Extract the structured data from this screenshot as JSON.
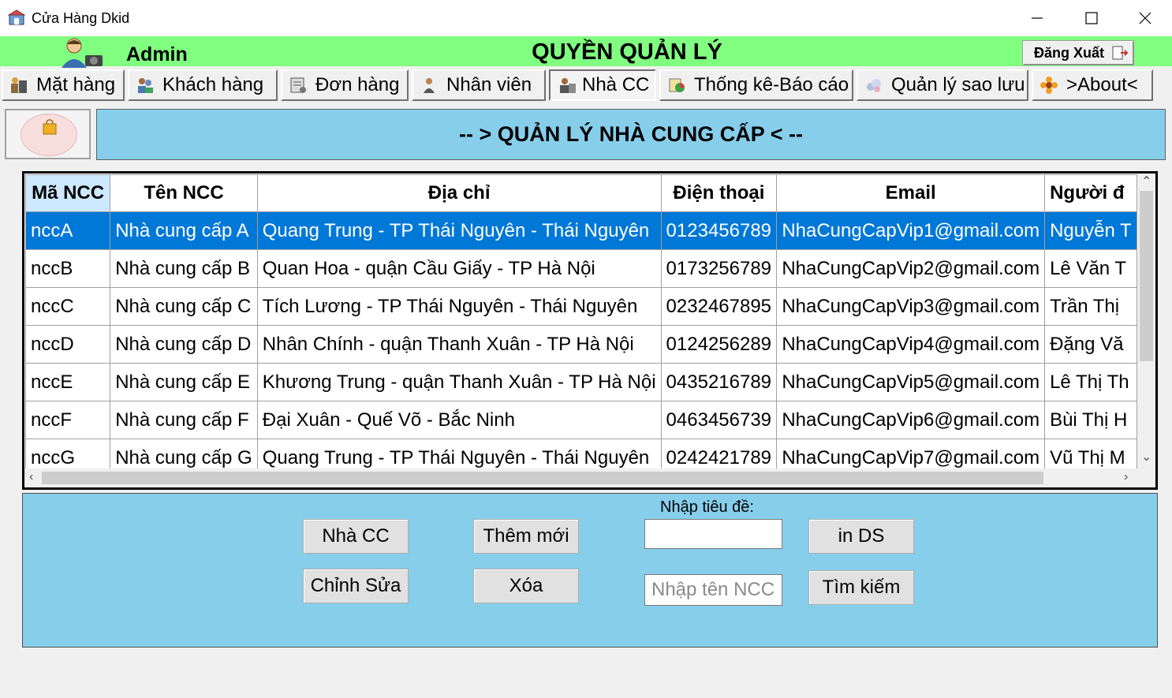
{
  "window": {
    "title": "Cửa Hàng Dkid"
  },
  "header": {
    "user": "Admin",
    "role_title": "QUYỀN QUẢN LÝ",
    "logout": "Đăng Xuất"
  },
  "tabs": [
    {
      "label": "Mặt hàng"
    },
    {
      "label": "Khách hàng"
    },
    {
      "label": "Đơn hàng"
    },
    {
      "label": "Nhân viên"
    },
    {
      "label": "Nhà CC"
    },
    {
      "label": "Thống kê-Báo cáo"
    },
    {
      "label": "Quản lý sao lưu"
    },
    {
      "label": ">About<"
    }
  ],
  "active_tab": "Nhà CC",
  "page_heading": "-- > QUẢN LÝ NHÀ CUNG CẤP < --",
  "grid": {
    "columns": [
      "Mã NCC",
      "Tên NCC",
      "Địa chỉ",
      "Điện thoại",
      "Email",
      "Người đ"
    ],
    "rows": [
      [
        "nccA",
        "Nhà cung cấp A",
        "Quang Trung - TP Thái Nguyên - Thái Nguyên",
        "0123456789",
        "NhaCungCapVip1@gmail.com",
        "Nguyễn T"
      ],
      [
        "nccB",
        "Nhà cung cấp B",
        "Quan Hoa - quận Cầu Giấy - TP Hà Nội",
        "0173256789",
        "NhaCungCapVip2@gmail.com",
        "Lê Văn T"
      ],
      [
        "nccC",
        "Nhà cung cấp C",
        "Tích Lương - TP Thái Nguyên - Thái Nguyên",
        "0232467895",
        "NhaCungCapVip3@gmail.com",
        "Trần Thị"
      ],
      [
        "nccD",
        "Nhà cung cấp D",
        "Nhân Chính - quận Thanh Xuân - TP Hà Nội",
        "0124256289",
        "NhaCungCapVip4@gmail.com",
        "Đặng Vă"
      ],
      [
        "nccE",
        "Nhà cung cấp E",
        "Khương Trung - quận Thanh Xuân - TP Hà Nội",
        "0435216789",
        "NhaCungCapVip5@gmail.com",
        "Lê Thị Th"
      ],
      [
        "nccF",
        "Nhà cung cấp F",
        "Đại Xuân -  Quế Võ - Bắc Ninh",
        "0463456739",
        "NhaCungCapVip6@gmail.com",
        "Bùi Thị H"
      ],
      [
        "nccG",
        "Nhà cung cấp G",
        "Quang Trung - TP Thái Nguyên - Thái Nguyên",
        "0242421789",
        "NhaCungCapVip7@gmail.com",
        "Vũ Thị M"
      ]
    ],
    "selected_row": 0
  },
  "actions": {
    "nha_cc": "Nhà CC",
    "them_moi": "Thêm mới",
    "chinh_sua": "Chỉnh Sửa",
    "xoa": "Xóa",
    "title_label": "Nhập tiêu đề:",
    "title_value": "",
    "print": "in DS",
    "search_placeholder": "Nhập tên NCC",
    "search": "Tìm kiếm"
  }
}
